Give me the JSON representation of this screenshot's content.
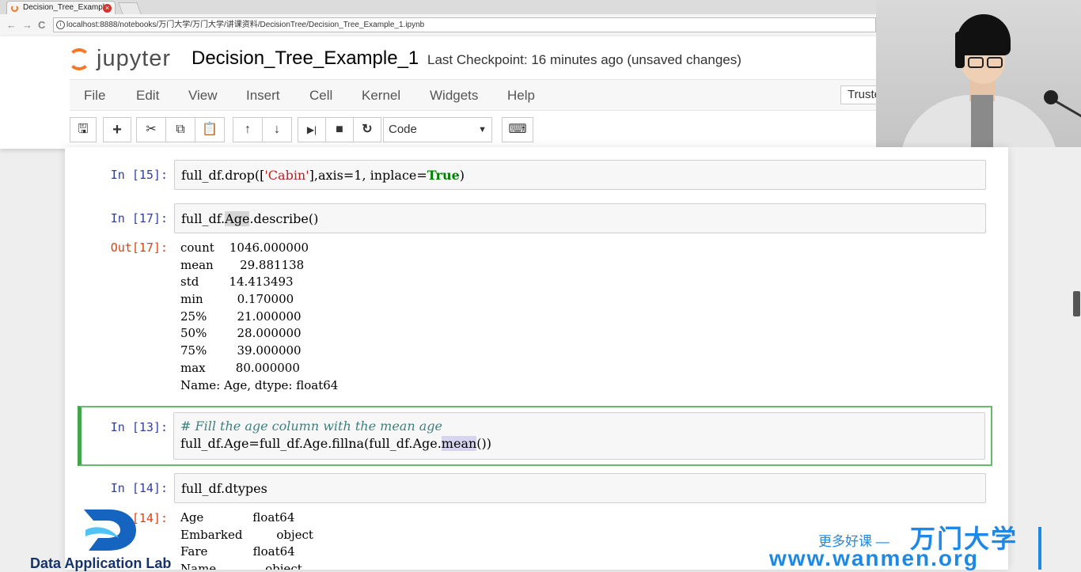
{
  "browser": {
    "tab_title": "Decision_Tree_Exampl",
    "tab_close": "×",
    "url": "localhost:8888/notebooks/万门大学/万门大学/讲课资料/DecisionTree/Decision_Tree_Example_1.ipynb",
    "nav": {
      "back": "←",
      "forward": "→",
      "reload": "C",
      "info": "i"
    }
  },
  "jupyter": {
    "logo_text": "jupyter",
    "notebook_title": "Decision_Tree_Example_1",
    "checkpoint": "Last Checkpoint: 16 minutes ago (unsaved changes)",
    "menu": [
      "File",
      "Edit",
      "View",
      "Insert",
      "Cell",
      "Kernel",
      "Widgets",
      "Help"
    ],
    "trusted": "Trusted",
    "celltype": "Code",
    "toolbar_glyphs": {
      "save": "🖫",
      "add": "+",
      "cut": "✂",
      "copy": "⧉",
      "paste": "📋",
      "up": "↑",
      "down": "↓",
      "run": "▶|",
      "stop": "■",
      "restart": "↻",
      "keyboard": "⌨",
      "caret": "▼"
    }
  },
  "cells": [
    {
      "prompt": "In  [15]:",
      "code_parts": [
        "full_df.drop([",
        "'Cabin'",
        "],axis=1, inplace=",
        "True",
        ")"
      ]
    },
    {
      "prompt": "In  [17]:",
      "code_parts": [
        "full_df.",
        "Age",
        ".describe()"
      ],
      "out_prompt": "Out[17]:",
      "output": [
        "count    1046.000000",
        "mean       29.881138",
        "std        14.413493",
        "min         0.170000",
        "25%        21.000000",
        "50%        28.000000",
        "75%        39.000000",
        "max        80.000000",
        "Name: Age, dtype: float64"
      ]
    },
    {
      "prompt": "In  [13]:",
      "comment": "# Fill the age column with the mean age",
      "code_parts": [
        "full_df.Age=full_df.Age.fillna(full_df.Age.",
        "mean",
        "())"
      ]
    },
    {
      "prompt": "In  [14]:",
      "code": "full_df.dtypes",
      "out_prompt": "[14]:",
      "output": [
        "Age             float64",
        "Embarked         object",
        "Fare            float64",
        "Name             object"
      ]
    }
  ],
  "watermarks": {
    "lab": "Data Application Lab",
    "slogan": "更多好课 —",
    "brand_cn": "万门大学",
    "brand_url": "www.wanmen.org"
  },
  "colors": {
    "jupyter_orange": "#f37726",
    "prompt_in": "#303f9f",
    "prompt_out": "#d84315",
    "selected_border": "#66bb6a",
    "string": "#ba2121",
    "keyword": "#008000",
    "comment": "#408080",
    "wanmen_blue": "#1e88e5"
  }
}
